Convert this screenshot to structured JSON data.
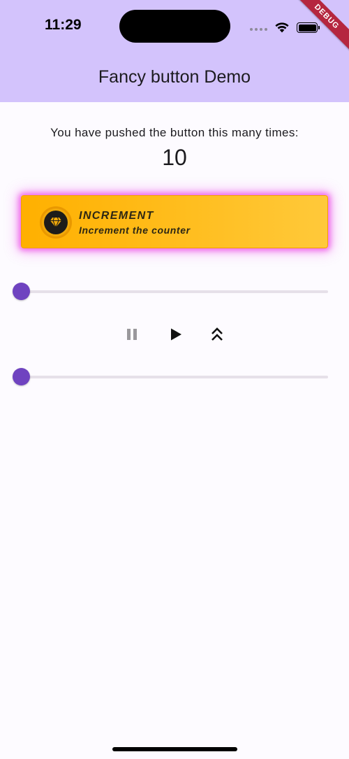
{
  "status_bar": {
    "time": "11:29",
    "icons": [
      "cellular-dots-icon",
      "wifi-icon",
      "battery-icon"
    ]
  },
  "debug_banner": "DEBUG",
  "app_bar": {
    "title": "Fancy button Demo",
    "background": "#d3c3fc"
  },
  "main": {
    "prompt": "You have pushed the button this many times:",
    "counter": "10",
    "fancy_button": {
      "title": "INCREMENT",
      "subtitle": "Increment the counter",
      "icon": "diamond-icon",
      "gradient": [
        "#ffb000",
        "#ffc93a"
      ],
      "glow_color": "#ec46e6"
    },
    "slider_1": {
      "value": 0.0,
      "color": "#6f43c0"
    },
    "playback_controls": [
      {
        "name": "pause",
        "icon": "pause-icon",
        "enabled": false
      },
      {
        "name": "play",
        "icon": "play-icon",
        "enabled": true
      },
      {
        "name": "speed-up",
        "icon": "double-chevron-up-icon",
        "enabled": true
      }
    ],
    "slider_2": {
      "value": 0.0,
      "color": "#6f43c0"
    }
  }
}
